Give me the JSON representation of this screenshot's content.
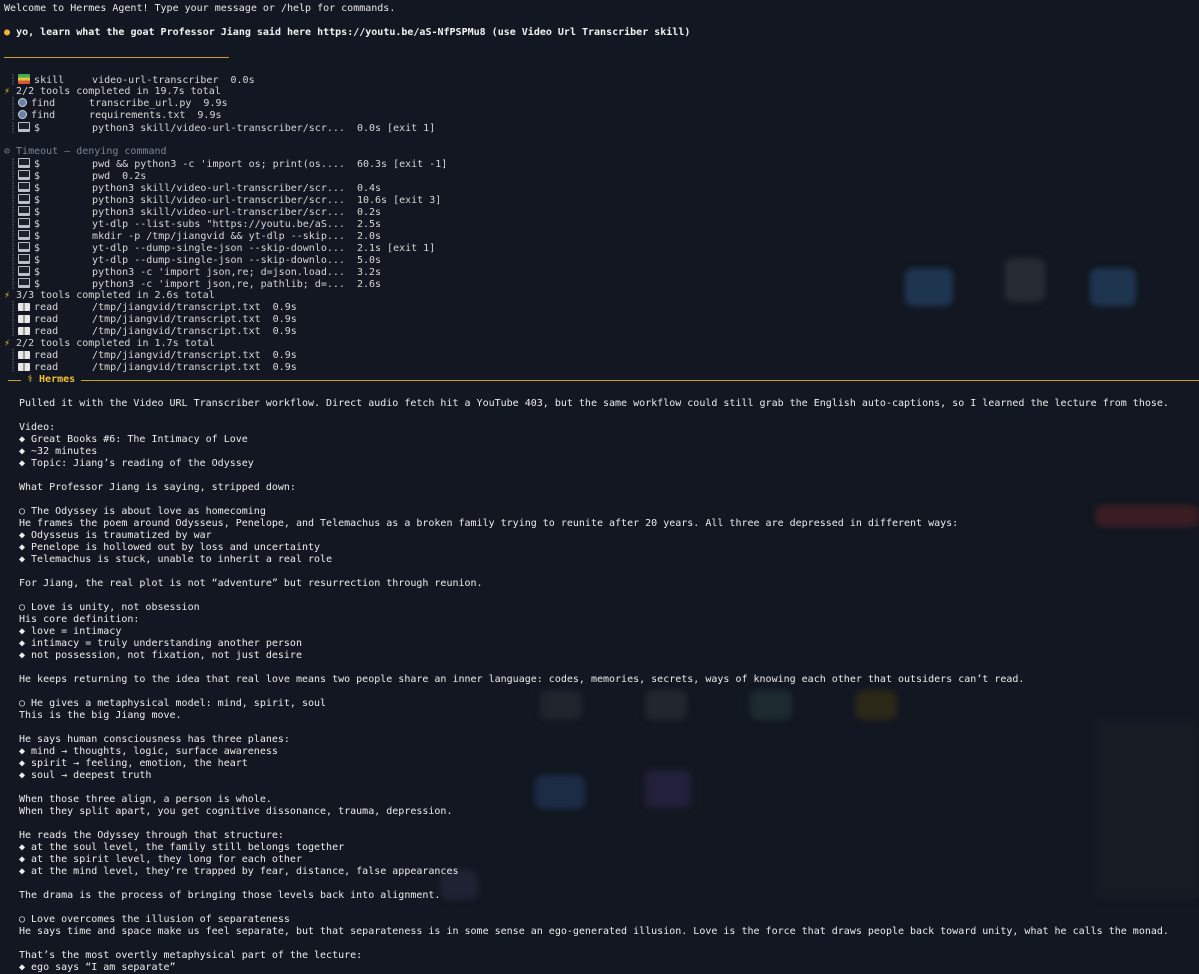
{
  "welcome": "Welcome to Hermes Agent! Type your message or /help for commands.",
  "user_message": "yo, learn what the goat Professor Jiang said here https://youtu.be/aS-NfPSPMu8 (use Video Url Transcriber skill)",
  "trace": [
    {
      "kind": "tool",
      "icon": "skill",
      "name": "skill",
      "detail": "video-url-transcriber  0.0s"
    },
    {
      "kind": "summary",
      "text": "2/2 tools completed in 19.7s total"
    },
    {
      "kind": "tool",
      "icon": "find",
      "name": "find",
      "detail": "transcribe_url.py  9.9s"
    },
    {
      "kind": "tool",
      "icon": "find",
      "name": "find",
      "detail": "requirements.txt  9.9s"
    },
    {
      "kind": "tool",
      "icon": "terminal",
      "name": "$",
      "detail": "python3 skill/video-url-transcriber/scr...  0.0s [exit 1]"
    },
    {
      "kind": "blank"
    },
    {
      "kind": "timeout",
      "text": "⊘ Timeout — denying command"
    },
    {
      "kind": "tool",
      "icon": "terminal",
      "name": "$",
      "detail": "pwd && python3 -c 'import os; print(os....  60.3s [exit -1]"
    },
    {
      "kind": "tool",
      "icon": "terminal",
      "name": "$",
      "detail": "pwd  0.2s"
    },
    {
      "kind": "tool",
      "icon": "terminal",
      "name": "$",
      "detail": "python3 skill/video-url-transcriber/scr...  0.4s"
    },
    {
      "kind": "tool",
      "icon": "terminal",
      "name": "$",
      "detail": "python3 skill/video-url-transcriber/scr...  10.6s [exit 3]"
    },
    {
      "kind": "tool",
      "icon": "terminal",
      "name": "$",
      "detail": "python3 skill/video-url-transcriber/scr...  0.2s"
    },
    {
      "kind": "tool",
      "icon": "terminal",
      "name": "$",
      "detail": "yt-dlp --list-subs \"https://youtu.be/aS...  2.5s"
    },
    {
      "kind": "tool",
      "icon": "terminal",
      "name": "$",
      "detail": "mkdir -p /tmp/jiangvid && yt-dlp --skip...  2.0s"
    },
    {
      "kind": "tool",
      "icon": "terminal",
      "name": "$",
      "detail": "yt-dlp --dump-single-json --skip-downlo...  2.1s [exit 1]"
    },
    {
      "kind": "tool",
      "icon": "terminal",
      "name": "$",
      "detail": "yt-dlp --dump-single-json --skip-downlo...  5.0s"
    },
    {
      "kind": "tool",
      "icon": "terminal",
      "name": "$",
      "detail": "python3 -c 'import json,re; d=json.load...  3.2s"
    },
    {
      "kind": "tool",
      "icon": "terminal",
      "name": "$",
      "detail": "python3 -c 'import json,re, pathlib; d=...  2.6s"
    },
    {
      "kind": "summary",
      "text": "3/3 tools completed in 2.6s total"
    },
    {
      "kind": "tool",
      "icon": "read",
      "name": "read",
      "detail": "/tmp/jiangvid/transcript.txt  0.9s"
    },
    {
      "kind": "tool",
      "icon": "read",
      "name": "read",
      "detail": "/tmp/jiangvid/transcript.txt  0.9s"
    },
    {
      "kind": "tool",
      "icon": "read",
      "name": "read",
      "detail": "/tmp/jiangvid/transcript.txt  0.9s"
    },
    {
      "kind": "summary",
      "text": "2/2 tools completed in 1.7s total"
    },
    {
      "kind": "tool",
      "icon": "read",
      "name": "read",
      "detail": "/tmp/jiangvid/transcript.txt  0.9s"
    },
    {
      "kind": "tool",
      "icon": "read",
      "name": "read",
      "detail": "/tmp/jiangvid/transcript.txt  0.9s"
    }
  ],
  "assistant_label": "⚕ Hermes",
  "response": [
    "Pulled it with the Video URL Transcriber workflow. Direct audio fetch hit a YouTube 403, but the same workflow could still grab the English auto-captions, so I learned the lecture from those.",
    "",
    "Video:",
    "◆ Great Books #6: The Intimacy of Love",
    "◆ ~32 minutes",
    "◆ Topic: Jiang’s reading of the Odyssey",
    "",
    "What Professor Jiang is saying, stripped down:",
    "",
    "○ The Odyssey is about love as homecoming",
    "He frames the poem around Odysseus, Penelope, and Telemachus as a broken family trying to reunite after 20 years. All three are depressed in different ways:",
    "◆ Odysseus is traumatized by war",
    "◆ Penelope is hollowed out by loss and uncertainty",
    "◆ Telemachus is stuck, unable to inherit a real role",
    "",
    "For Jiang, the real plot is not “adventure” but resurrection through reunion.",
    "",
    "○ Love is unity, not obsession",
    "His core definition:",
    "◆ love = intimacy",
    "◆ intimacy = truly understanding another person",
    "◆ not possession, not fixation, not just desire",
    "",
    "He keeps returning to the idea that real love means two people share an inner language: codes, memories, secrets, ways of knowing each other that outsiders can’t read.",
    "",
    "○ He gives a metaphysical model: mind, spirit, soul",
    "This is the big Jiang move.",
    "",
    "He says human consciousness has three planes:",
    "◆ mind → thoughts, logic, surface awareness",
    "◆ spirit → feeling, emotion, the heart",
    "◆ soul → deepest truth",
    "",
    "When those three align, a person is whole.",
    "When they split apart, you get cognitive dissonance, trauma, depression.",
    "",
    "He reads the Odyssey through that structure:",
    "◆ at the soul level, the family still belongs together",
    "◆ at the spirit level, they long for each other",
    "◆ at the mind level, they’re trapped by fear, distance, false appearances",
    "",
    "The drama is the process of bringing those levels back into alignment.",
    "",
    "○ Love overcomes the illusion of separateness",
    "He says time and space make us feel separate, but that separateness is in some sense an ego-generated illusion. Love is the force that draws people back toward unity, what he calls the monad.",
    "",
    "That’s the most overtly metaphysical part of the lecture:",
    "◆ ego says “I am separate”"
  ]
}
